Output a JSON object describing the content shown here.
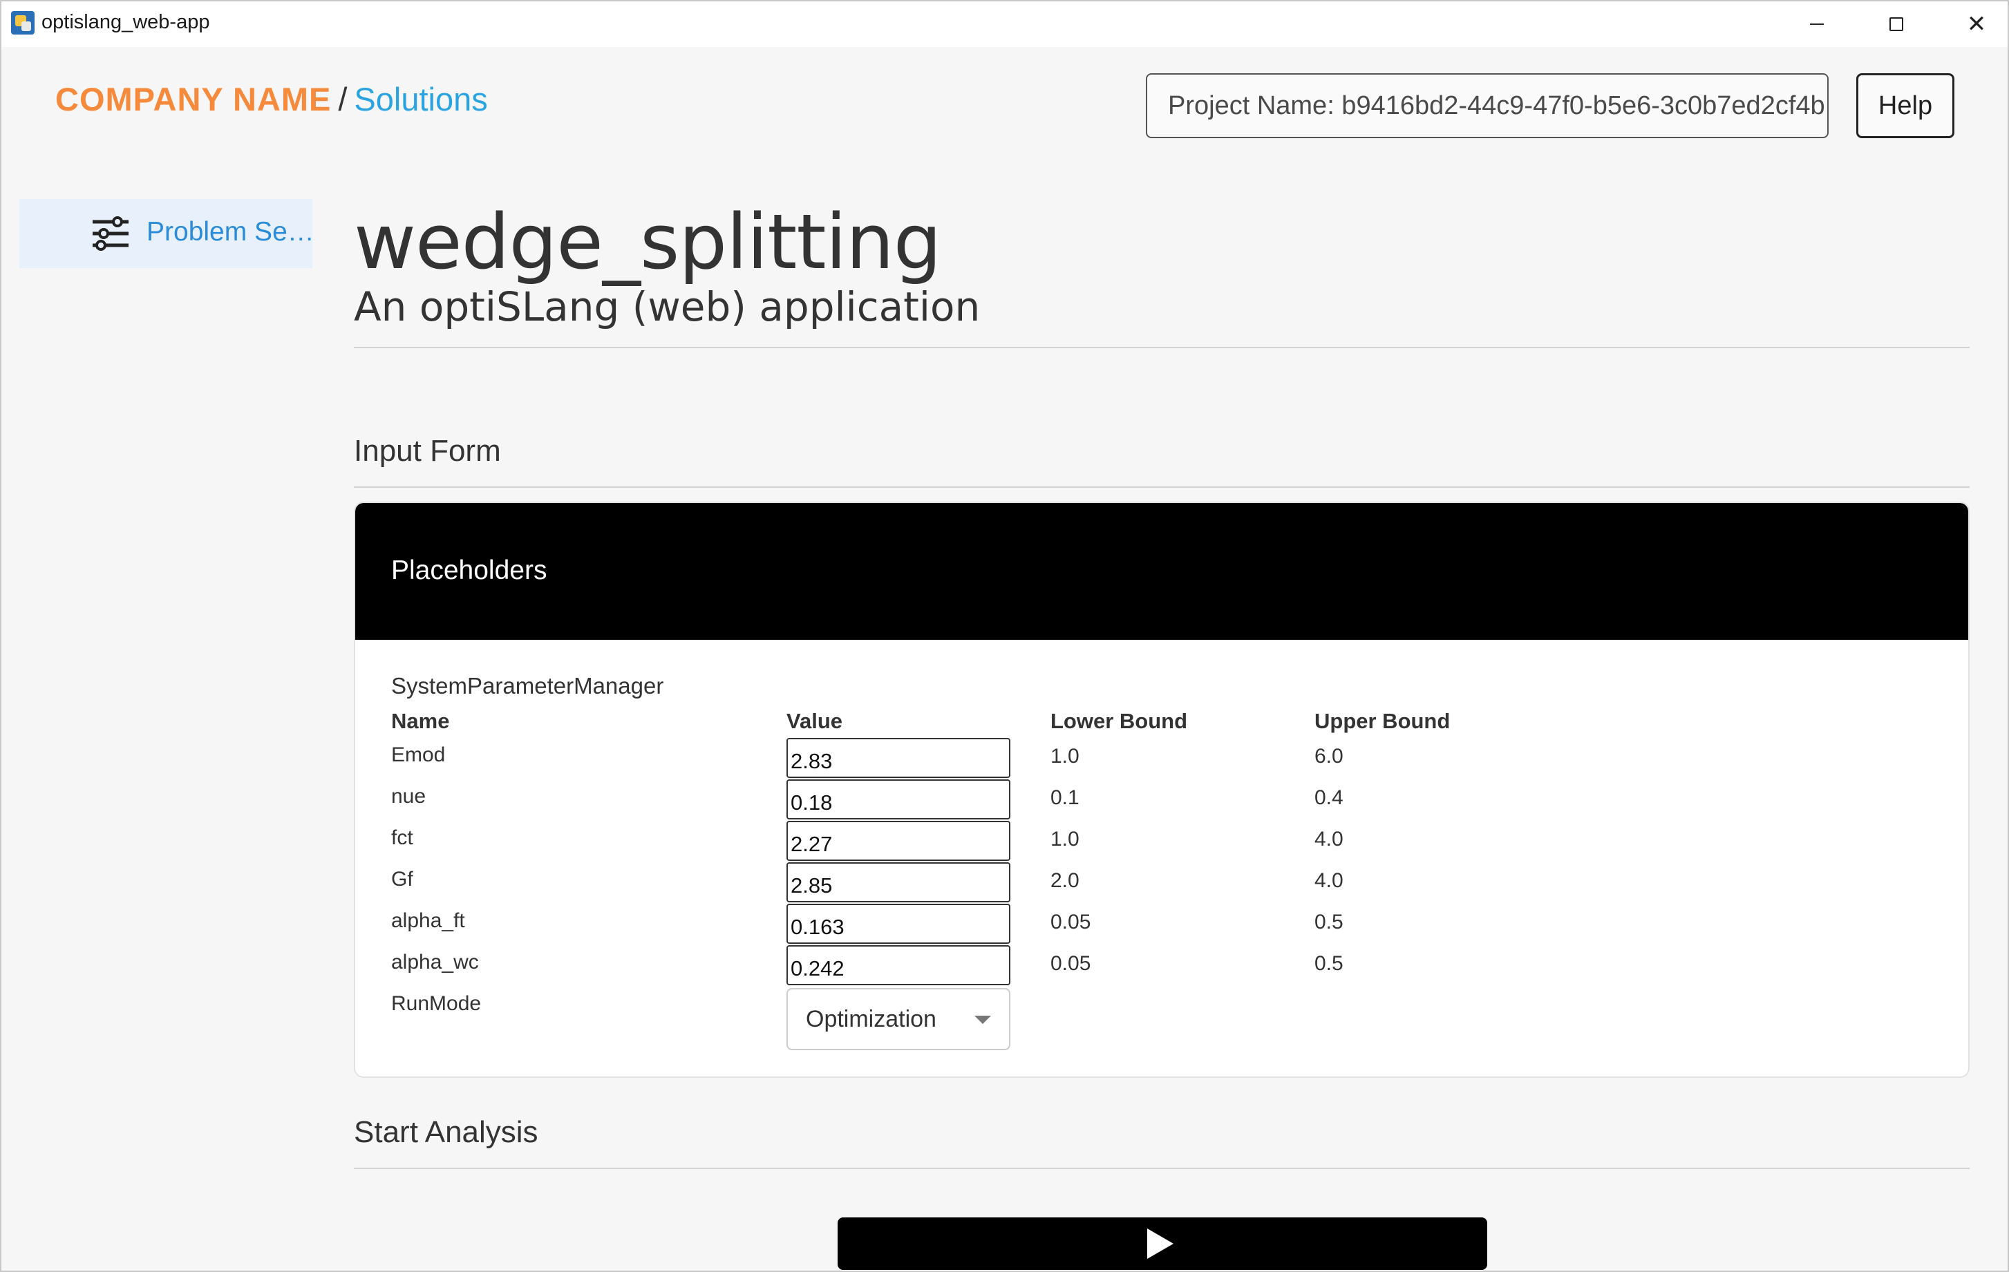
{
  "window": {
    "title": "optislang_web-app",
    "controls": {
      "minimize": "minimize",
      "maximize": "maximize",
      "close": "✕"
    }
  },
  "header": {
    "company": "COMPANY NAME",
    "separator": "/",
    "section": "Solutions",
    "project_name": "Project Name: b9416bd2-44c9-47f0-b5e6-3c0b7ed2cf4b",
    "help_label": "Help"
  },
  "sidebar": {
    "items": [
      {
        "label": "Problem Se…",
        "icon": "sliders-icon",
        "selected": true
      }
    ]
  },
  "main": {
    "title": "wedge_splitting",
    "subtitle": "An optiSLang (web) application",
    "input_form": {
      "heading": "Input Form",
      "card_title": "Placeholders",
      "manager_label": "SystemParameterManager",
      "columns": [
        "Name",
        "Value",
        "Lower Bound",
        "Upper Bound"
      ],
      "rows": [
        {
          "name": "Emod",
          "value": "2.83",
          "lower": "1.0",
          "upper": "6.0"
        },
        {
          "name": "nue",
          "value": "0.18",
          "lower": "0.1",
          "upper": "0.4"
        },
        {
          "name": "fct",
          "value": "2.27",
          "lower": "1.0",
          "upper": "4.0"
        },
        {
          "name": "Gf",
          "value": "2.85",
          "lower": "2.0",
          "upper": "4.0"
        },
        {
          "name": "alpha_ft",
          "value": "0.163",
          "lower": "0.05",
          "upper": "0.5"
        },
        {
          "name": "alpha_wc",
          "value": "0.242",
          "lower": "0.05",
          "upper": "0.5"
        }
      ],
      "run_mode": {
        "name": "RunMode",
        "selected": "Optimization"
      }
    },
    "start_analysis": {
      "heading": "Start Analysis",
      "run_icon": "play-icon"
    }
  },
  "colors": {
    "company": "#f58a3c",
    "link": "#2aa3e0",
    "sidebar_selected_bg": "#e8f1fb",
    "card_header_bg": "#000000",
    "page_bg": "#f6f6f6"
  }
}
